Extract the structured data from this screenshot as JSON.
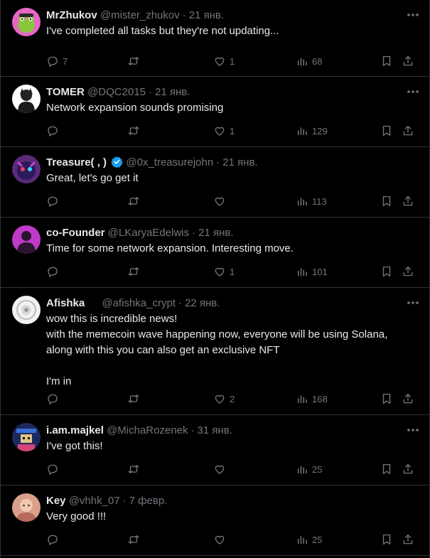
{
  "tweets": [
    {
      "name": "MrZhukov",
      "handle": "@mister_zhukov",
      "sep": "·",
      "time": "21 янв.",
      "text": "I've completed all tasks but they're not updating...",
      "replies": "7",
      "reposts": "",
      "likes": "1",
      "views": "68",
      "avatar_icon": "green-frog-avatar",
      "avatar_bg": "#e866c6"
    },
    {
      "name": "TOMER",
      "handle": "@DQC2015",
      "sep": "·",
      "time": "21 янв.",
      "text": "Network expansion sounds promising",
      "replies": "",
      "reposts": "",
      "likes": "1",
      "views": "129",
      "avatar_icon": "dark-figure-avatar",
      "avatar_bg": "#ffffff"
    },
    {
      "name": "Treasure(     ,     )",
      "verified": true,
      "handle": "@0x_treasurejohn",
      "sep": "·",
      "time": "21 янв.",
      "text": "Great, let's go get it",
      "replies": "",
      "reposts": "",
      "likes": "",
      "views": "113",
      "avatar_icon": "purple-creature-avatar",
      "avatar_bg": "#5b2a7a"
    },
    {
      "name": "co-Founder",
      "handle": "@LKaryaEdelwis",
      "sep": "·",
      "time": "21 янв.",
      "text": "Time for some network expansion. Interesting move.",
      "replies": "",
      "reposts": "",
      "likes": "1",
      "views": "101",
      "avatar_icon": "silhouette-avatar",
      "avatar_bg": "#c03ac8"
    },
    {
      "name": "Afishka",
      "handle": "@afishka_crypt",
      "sep": "·",
      "time": "22 янв.",
      "text": "wow       this is incredible news!\nwith the memecoin wave happening now, everyone will be using Solana, along with this you can also get an exclusive NFT\n\n I'm in",
      "replies": "",
      "reposts": "",
      "likes": "2",
      "views": "168",
      "avatar_icon": "round-badge-avatar",
      "avatar_bg": "#f2f2f2"
    },
    {
      "name": "i.am.majkel",
      "handle": "@MichaRozenek",
      "sep": "·",
      "time": "31 янв.",
      "text": "I've got this!",
      "replies": "",
      "reposts": "",
      "likes": "",
      "views": "25",
      "avatar_icon": "pixel-art-avatar",
      "avatar_bg": "#1b2a5c"
    },
    {
      "name": "Key",
      "handle": "@vhhk_07",
      "sep": "·",
      "time": "7 февр.",
      "text": "Very good !!!",
      "replies": "",
      "reposts": "",
      "likes": "",
      "views": "25",
      "avatar_icon": "portrait-avatar",
      "avatar_bg": "#d9a08a"
    }
  ],
  "colors": {
    "background": "#000000",
    "text": "#e7e9ea",
    "muted": "#71767b",
    "divider": "#2f3336",
    "verified": "#1d9bf0"
  }
}
